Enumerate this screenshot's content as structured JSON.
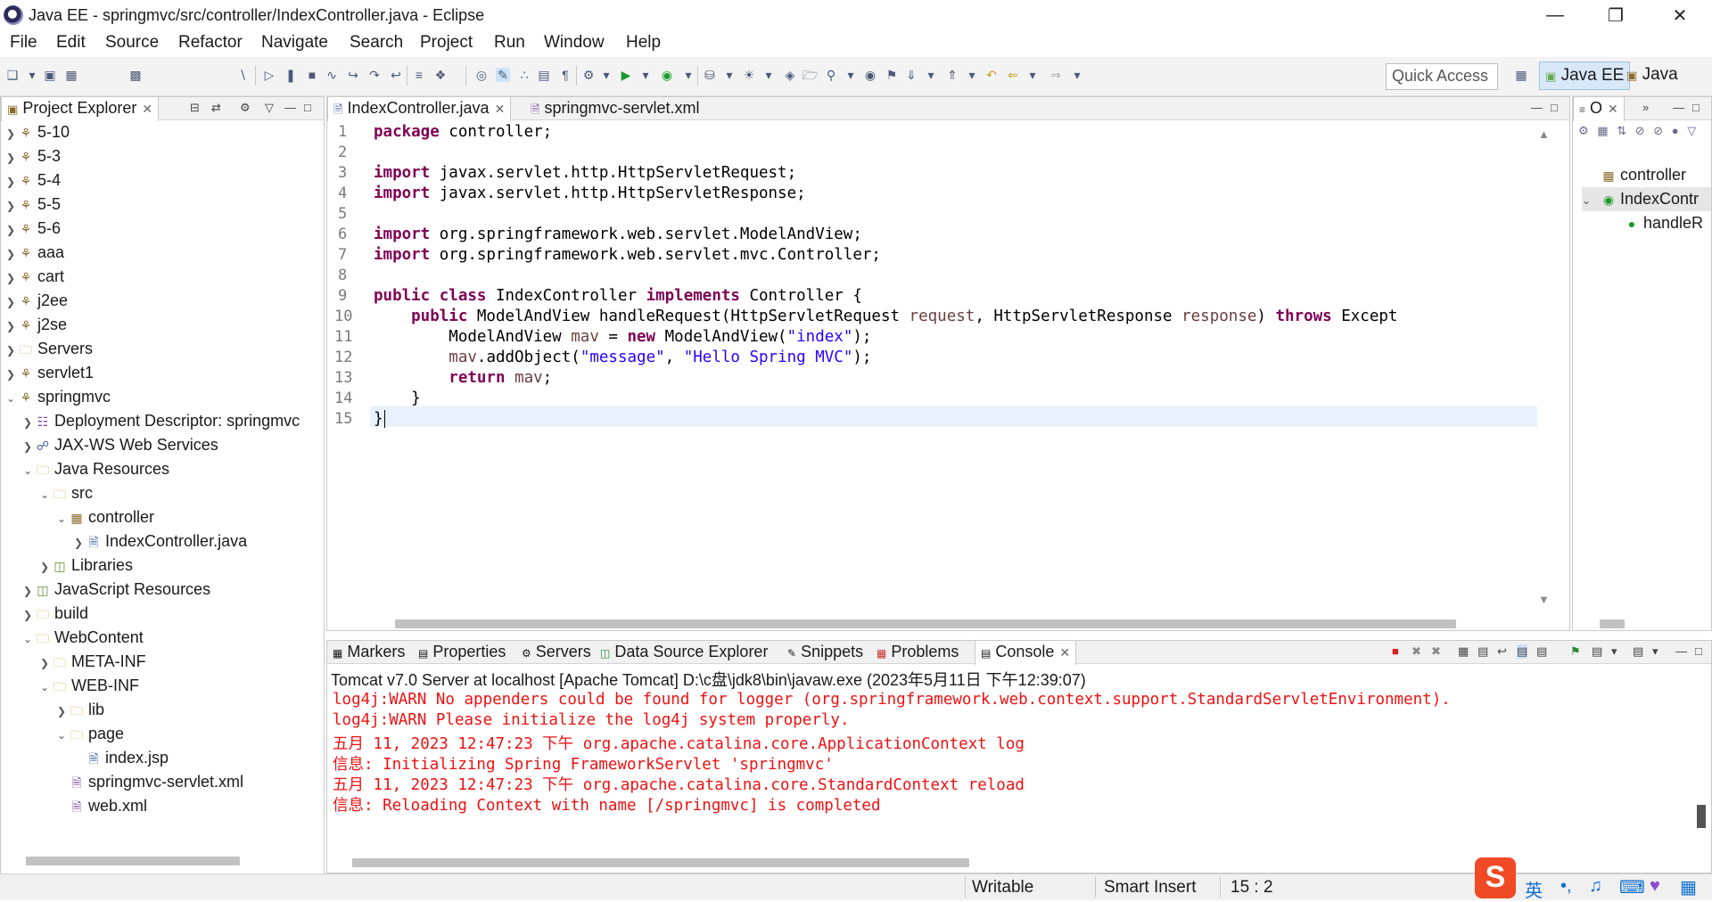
{
  "window": {
    "title": "Java EE - springmvc/src/controller/IndexController.java - Eclipse"
  },
  "menu": [
    "File",
    "Edit",
    "Source",
    "Refactor",
    "Navigate",
    "Search",
    "Project",
    "Run",
    "Window",
    "Help"
  ],
  "toolbar": {
    "quick_access_label": "Quick Access",
    "perspective_javaee": "Java EE",
    "perspective_java": "Java"
  },
  "explorer": {
    "tab_label": "Project Explorer",
    "items": [
      {
        "label": "5-10"
      },
      {
        "label": "5-3"
      },
      {
        "label": "5-4"
      },
      {
        "label": "5-5"
      },
      {
        "label": "5-6"
      },
      {
        "label": "aaa"
      },
      {
        "label": "cart"
      },
      {
        "label": "j2ee"
      },
      {
        "label": "j2se"
      },
      {
        "label": "Servers"
      },
      {
        "label": "servlet1"
      },
      {
        "label": "springmvc"
      },
      {
        "label": "Deployment Descriptor: springmvc"
      },
      {
        "label": "JAX-WS Web Services"
      },
      {
        "label": "Java Resources"
      },
      {
        "label": "src"
      },
      {
        "label": "controller"
      },
      {
        "label": "IndexController.java"
      },
      {
        "label": "Libraries"
      },
      {
        "label": "JavaScript Resources"
      },
      {
        "label": "build"
      },
      {
        "label": "WebContent"
      },
      {
        "label": "META-INF"
      },
      {
        "label": "WEB-INF"
      },
      {
        "label": "lib"
      },
      {
        "label": "page"
      },
      {
        "label": "index.jsp"
      },
      {
        "label": "springmvc-servlet.xml"
      },
      {
        "label": "web.xml"
      }
    ]
  },
  "editor": {
    "tabs": [
      {
        "label": "IndexController.java"
      },
      {
        "label": "springmvc-servlet.xml"
      }
    ],
    "line_numbers": [
      "1",
      "2",
      "3",
      "4",
      "5",
      "6",
      "7",
      "8",
      "9",
      "10",
      "11",
      "12",
      "13",
      "14",
      "15"
    ],
    "code": {
      "l1_kw": "package",
      "l1_rest": " controller;",
      "l3_kw": "import",
      "l3_rest": " javax.servlet.http.HttpServletRequest;",
      "l4_kw": "import",
      "l4_rest": " javax.servlet.http.HttpServletResponse;",
      "l6_kw": "import",
      "l6_rest": " org.springframework.web.servlet.ModelAndView;",
      "l7_kw": "import",
      "l7_rest": " org.springframework.web.servlet.mvc.Controller;",
      "l9_kw1": "public class",
      "l9_name": " IndexController ",
      "l9_kw2": "implements",
      "l9_rest": " Controller {",
      "l10_kw": "    public",
      "l10_a": " ModelAndView handleRequest(HttpServletRequest ",
      "l10_p1": "request",
      "l10_b": ", HttpServletResponse ",
      "l10_p2": "response",
      "l10_c": ") ",
      "l10_kw2": "throws",
      "l10_d": " Except",
      "l11_a": "        ModelAndView ",
      "l11_v": "mav",
      "l11_b": " = ",
      "l11_kw": "new",
      "l11_c": " ModelAndView(",
      "l11_s": "\"index\"",
      "l11_d": ");",
      "l12_a": "        ",
      "l12_v": "mav",
      "l12_b": ".addObject(",
      "l12_s1": "\"message\"",
      "l12_c": ", ",
      "l12_s2": "\"Hello Spring MVC\"",
      "l12_d": ");",
      "l13_kw": "        return",
      "l13_a": " ",
      "l13_v": "mav",
      "l13_b": ";",
      "l14": "    }",
      "l15": "}"
    }
  },
  "outline": {
    "tab_label": "O",
    "items": [
      {
        "label": "controller"
      },
      {
        "label": "IndexContr"
      },
      {
        "label": "handleR"
      }
    ]
  },
  "bottom": {
    "tabs": [
      {
        "label": "Markers"
      },
      {
        "label": "Properties"
      },
      {
        "label": "Servers"
      },
      {
        "label": "Data Source Explorer"
      },
      {
        "label": "Snippets"
      },
      {
        "label": "Problems"
      },
      {
        "label": "Console"
      }
    ],
    "console_header": "Tomcat v7.0 Server at localhost [Apache Tomcat] D:\\c盘\\jdk8\\bin\\javaw.exe (2023年5月11日 下午12:39:07)",
    "console_lines": [
      "log4j:WARN No appenders could be found for logger (org.springframework.web.context.support.StandardServletEnvironment).",
      "log4j:WARN Please initialize the log4j system properly.",
      "五月 11, 2023 12:47:23 下午 org.apache.catalina.core.ApplicationContext log",
      "信息: Initializing Spring FrameworkServlet 'springmvc'",
      "五月 11, 2023 12:47:23 下午 org.apache.catalina.core.StandardContext reload",
      "信息: Reloading Context with name [/springmvc] is completed"
    ]
  },
  "status": {
    "writable": "Writable",
    "insert_mode": "Smart Insert",
    "position": "15 : 2"
  },
  "ime": {
    "lang": "英"
  }
}
